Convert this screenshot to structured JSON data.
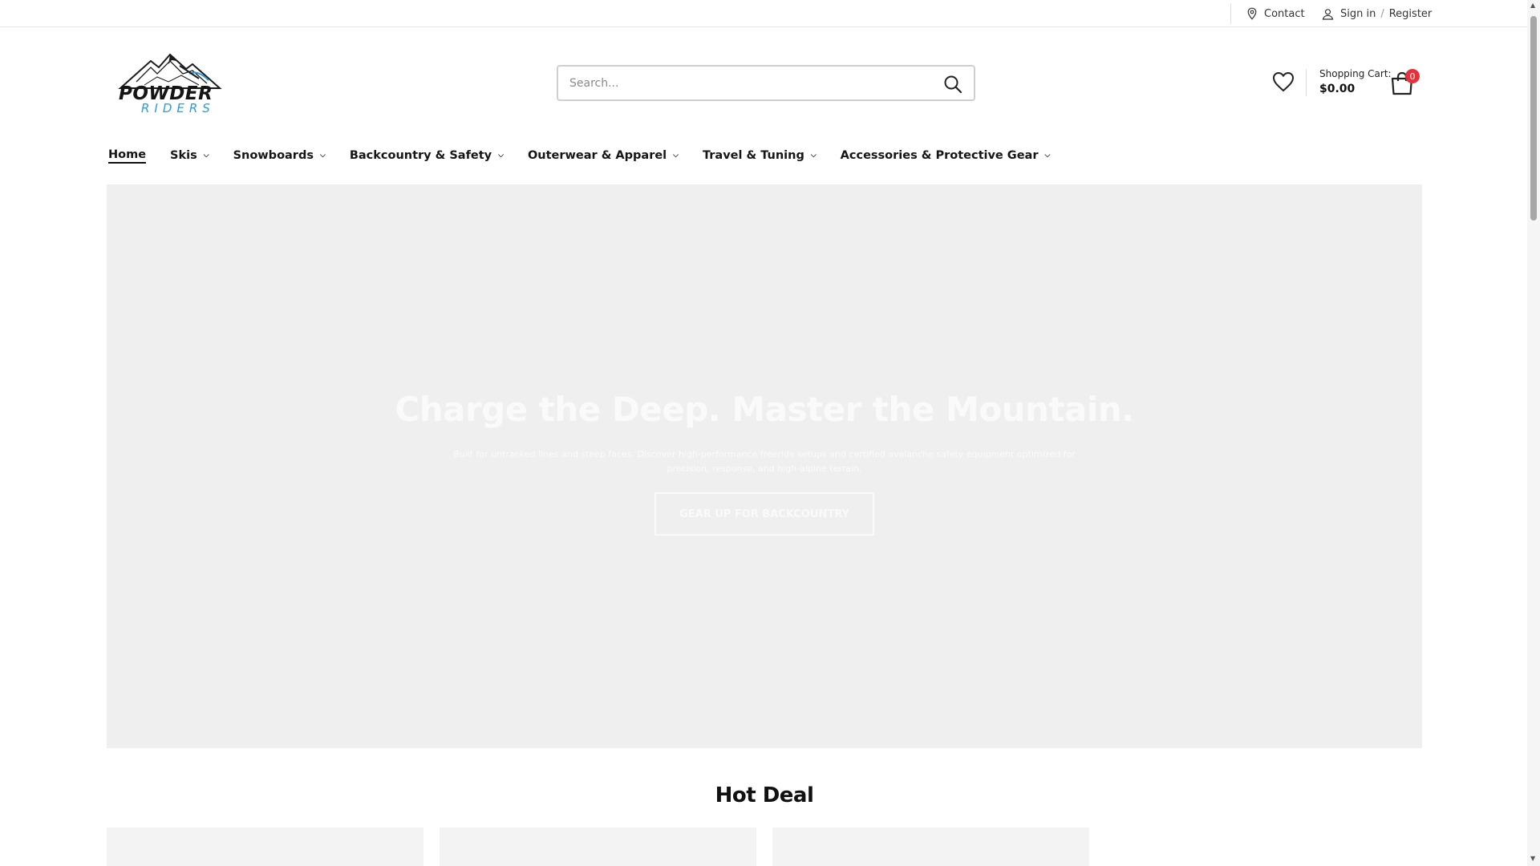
{
  "topbar": {
    "contact_label": "Contact",
    "signin_label": "Sign in",
    "separator": "/",
    "register_label": "Register"
  },
  "logo": {
    "line1": "POWDER",
    "line2": "RIDERS"
  },
  "search": {
    "placeholder": "Search..."
  },
  "cart": {
    "label": "Shopping Cart:",
    "total": "$0.00",
    "count": "0"
  },
  "nav": {
    "items": [
      {
        "label": "Home"
      },
      {
        "label": "Skis"
      },
      {
        "label": "Snowboards"
      },
      {
        "label": "Backcountry & Safety"
      },
      {
        "label": "Outerwear & Apparel"
      },
      {
        "label": "Travel & Tuning"
      },
      {
        "label": "Accessories & Protective Gear"
      }
    ]
  },
  "hero": {
    "title": "Charge the Deep. Master the Mountain.",
    "subtitle": "Built for untracked lines and steep faces. Discover high-performance freeride setups and certified avalanche safety equipment optimized for precision, response, and high-alpine terrain.",
    "cta_label": "GEAR UP FOR BACKCOUNTRY"
  },
  "hot_deal": {
    "title": "Hot Deal"
  },
  "colors": {
    "badge": "#e8303a",
    "accent_blue": "#2b9ad8",
    "hero_bg": "#efefef"
  }
}
